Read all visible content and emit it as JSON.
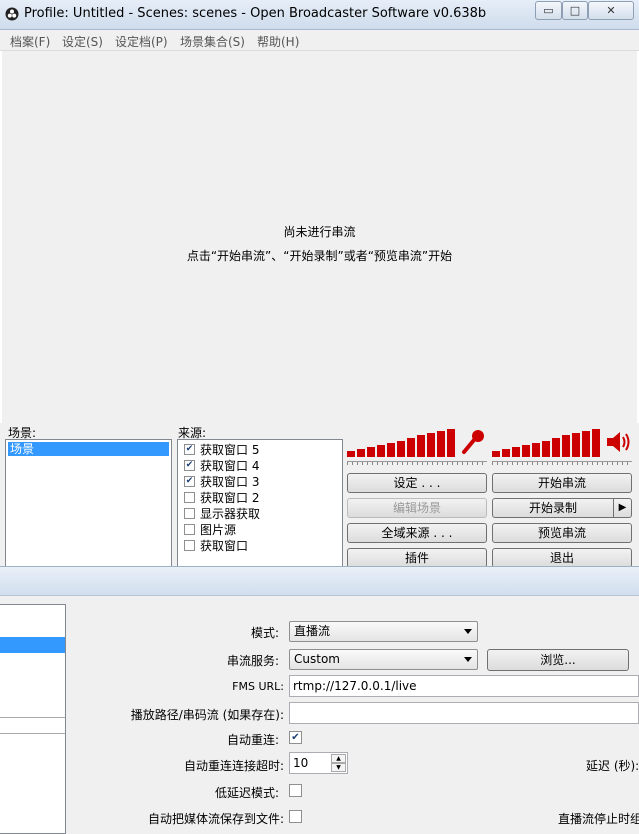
{
  "window": {
    "title": "Profile: Untitled - Scenes: scenes - Open Broadcaster Software v0.638b"
  },
  "window_controls": {
    "minimize": "▭",
    "maximize": "□",
    "close": "✕"
  },
  "menu": [
    "档案(F)",
    "设定(S)",
    "设定档(P)",
    "场景集合(S)",
    "帮助(H)"
  ],
  "preview": {
    "line1": "尚未进行串流",
    "line2": "点击“开始串流”、“开始录制”或者“预览串流”开始"
  },
  "scenes": {
    "label": "场景:",
    "items": [
      "场景"
    ]
  },
  "sources": {
    "label": "来源:",
    "items": [
      {
        "name": "获取窗口 5",
        "checked": true
      },
      {
        "name": "获取窗口 4",
        "checked": true
      },
      {
        "name": "获取窗口 3",
        "checked": true
      },
      {
        "name": "获取窗口 2",
        "checked": false
      },
      {
        "name": "显示器获取",
        "checked": false
      },
      {
        "name": "图片源",
        "checked": false
      },
      {
        "name": "获取窗口",
        "checked": false
      }
    ]
  },
  "buttons": {
    "settings": "设定 . . .",
    "edit_scene": "编辑场景",
    "global_sources": "全域来源 . . .",
    "plugins": "插件",
    "start_stream": "开始串流",
    "start_record": "开始录制",
    "preview_stream": "预览串流",
    "exit": "退出"
  },
  "stream_settings": {
    "mode_label": "模式:",
    "mode_value": "直播流",
    "service_label": "串流服务:",
    "service_value": "Custom",
    "browse": "浏览...",
    "fms_label": "FMS URL:",
    "fms_value": "rtmp://127.0.0.1/live",
    "path_label": "播放路径/串码流 (如果存在):",
    "path_value": "",
    "auto_reconnect_label": "自动重连:",
    "auto_reconnect": true,
    "timeout_label": "自动重连连接超时:",
    "timeout_value": "10",
    "delay_label": "延迟 (秒):",
    "low_latency_label": "低延迟模式:",
    "low_latency": false,
    "save_label": "自动把媒体流保存到文件:",
    "save_to_file": false,
    "stop_label": "直播流停止时组"
  },
  "colors": {
    "meter": "#cc0000",
    "selection": "#3399ff"
  }
}
